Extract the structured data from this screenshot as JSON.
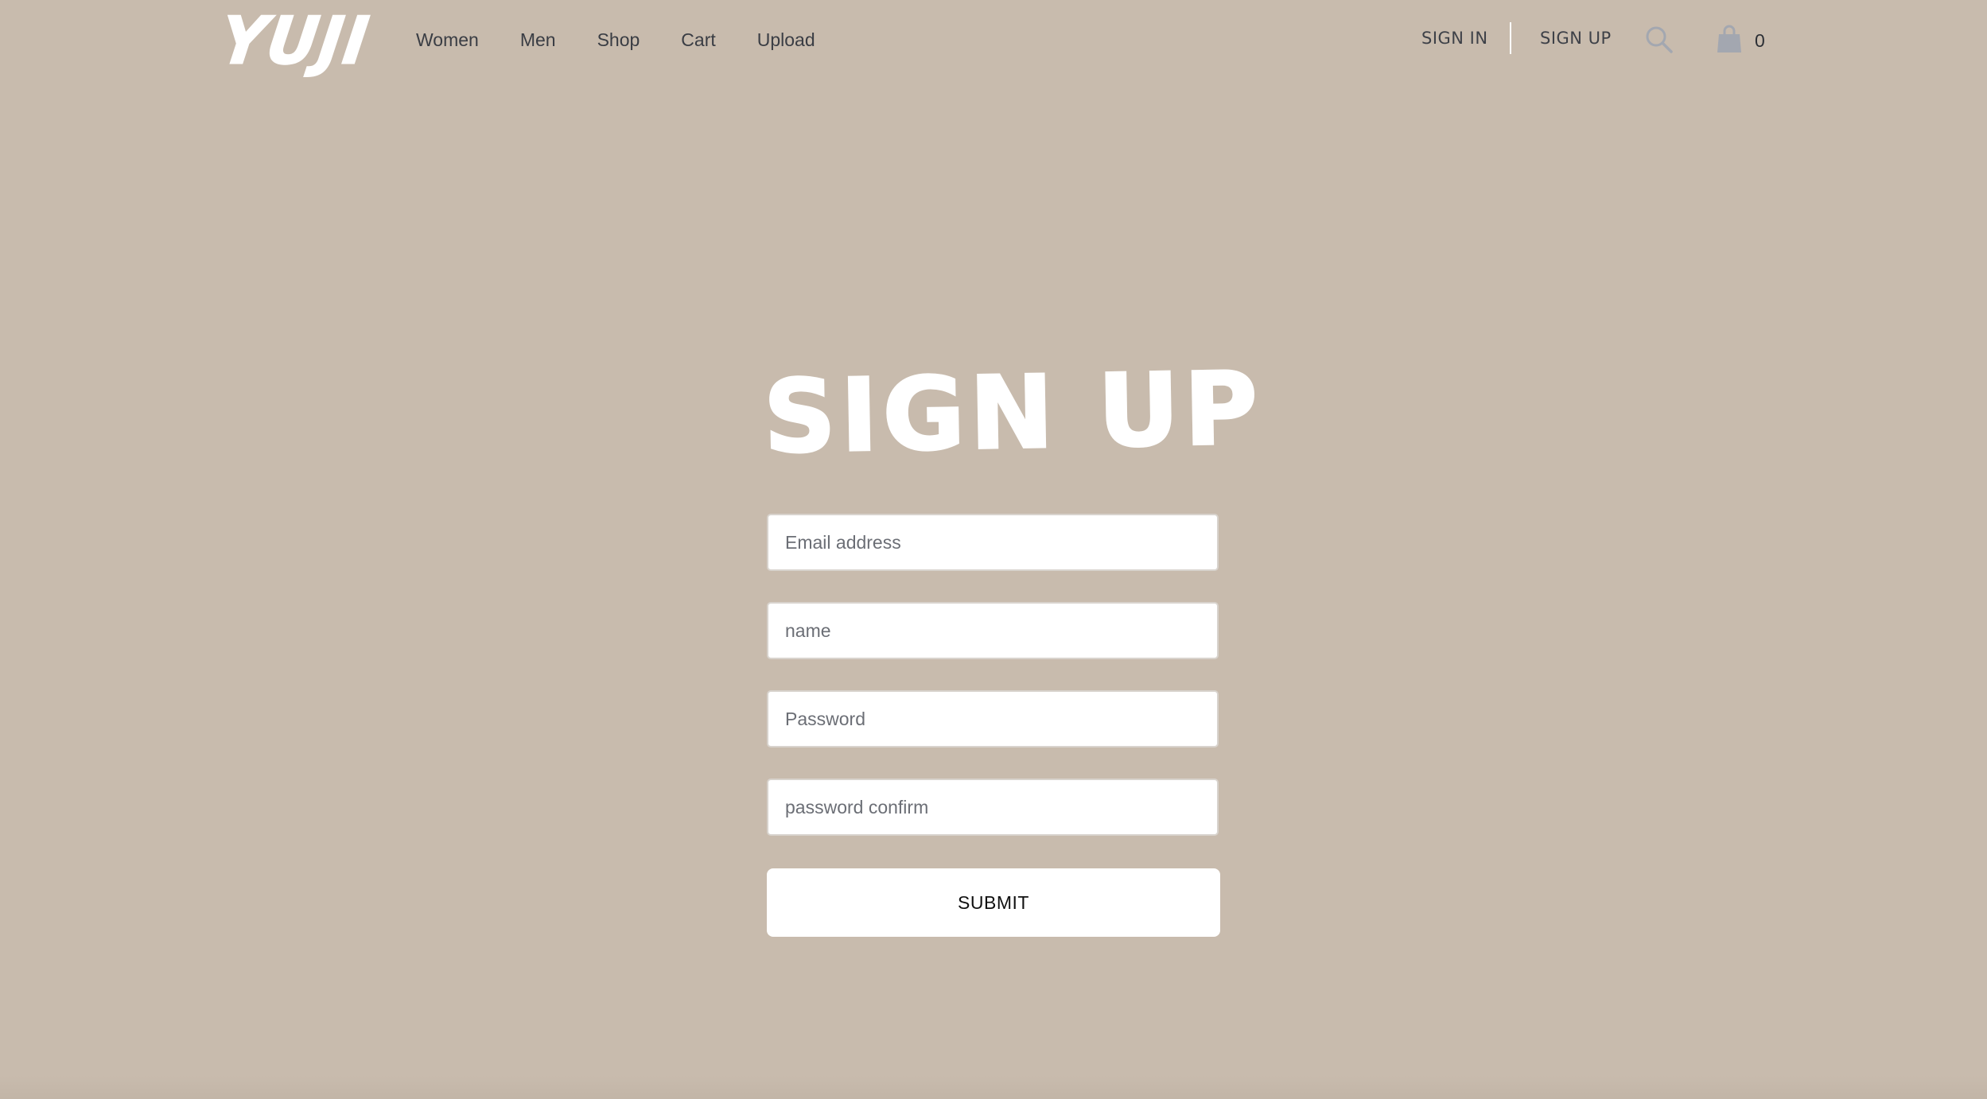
{
  "header": {
    "logo_text": "YUJI",
    "nav_items": [
      "Women",
      "Men",
      "Shop",
      "Cart",
      "Upload"
    ],
    "sign_in": "SIGN IN",
    "sign_up": "SIGN UP",
    "search_icon": "search-icon",
    "bag_icon": "shopping-bag-icon",
    "cart_count": "0"
  },
  "main": {
    "title": "Sign Up",
    "fields": {
      "email_placeholder": "Email address",
      "name_placeholder": "name",
      "password_placeholder": "Password",
      "password_confirm_placeholder": "password confirm"
    },
    "submit_label": "SUBMIT"
  },
  "colors": {
    "background": "#c8bbad",
    "icon": "#a3a7b0",
    "text": "#3a3d44"
  }
}
